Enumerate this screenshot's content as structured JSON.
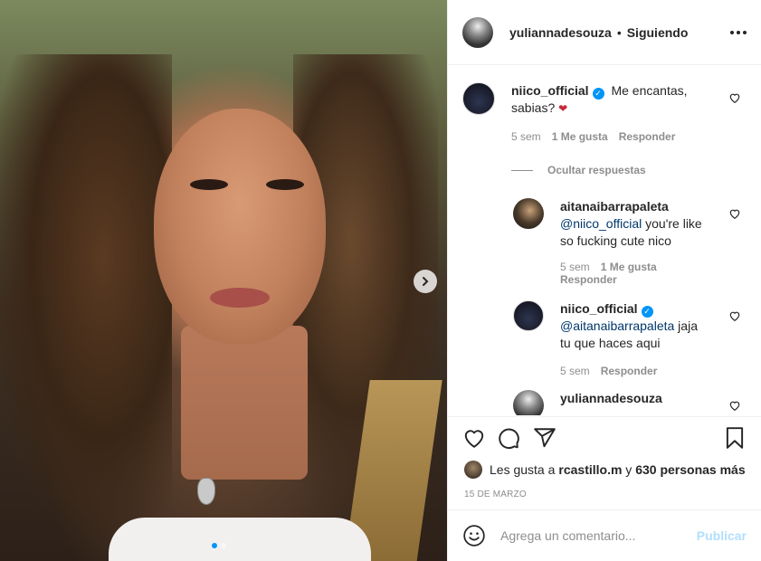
{
  "header": {
    "username": "yuliannadesouza",
    "separator": "•",
    "follow_status": "Siguiendo"
  },
  "comments": [
    {
      "username": "niico_official",
      "verified": true,
      "text_line1": "Me encantas,",
      "text_line2": "sabias?",
      "emoji": "❤",
      "time": "5 sem",
      "likes": "1 Me gusta",
      "reply": "Responder"
    }
  ],
  "hide_replies": "Ocultar respuestas",
  "replies": [
    {
      "username": "aitanaibarrapaleta",
      "mention": "@niico_official",
      "text_line1": " you're like",
      "text_line2": "so fucking cute nico",
      "time": "5 sem",
      "likes": "1 Me gusta",
      "reply": "Responder"
    },
    {
      "username": "niico_official",
      "verified": true,
      "mention": "@aitanaibarrapaleta",
      "text_line1": " jaja",
      "text_line2": "tu que haces aqui",
      "time": "5 sem",
      "reply": "Responder"
    },
    {
      "username": "yuliannadesouza"
    }
  ],
  "likes_line": {
    "prefix": "Les gusta a ",
    "user": "rcastillo.m",
    "middle": " y ",
    "count": "630 personas más"
  },
  "date": "15 DE MARZO",
  "comment_box": {
    "placeholder": "Agrega un comentario...",
    "publish": "Publicar"
  },
  "icons": {
    "heart": "heart-icon",
    "comment": "comment-icon",
    "share": "share-icon",
    "save": "bookmark-icon",
    "emoji": "emoji-icon",
    "more": "more-icon"
  },
  "carousel": {
    "current": 1,
    "total": 2
  },
  "colors": {
    "link": "#00376b",
    "verified": "#0095f6",
    "muted": "#8e8e8e",
    "publish_disabled": "#b2dffc"
  }
}
